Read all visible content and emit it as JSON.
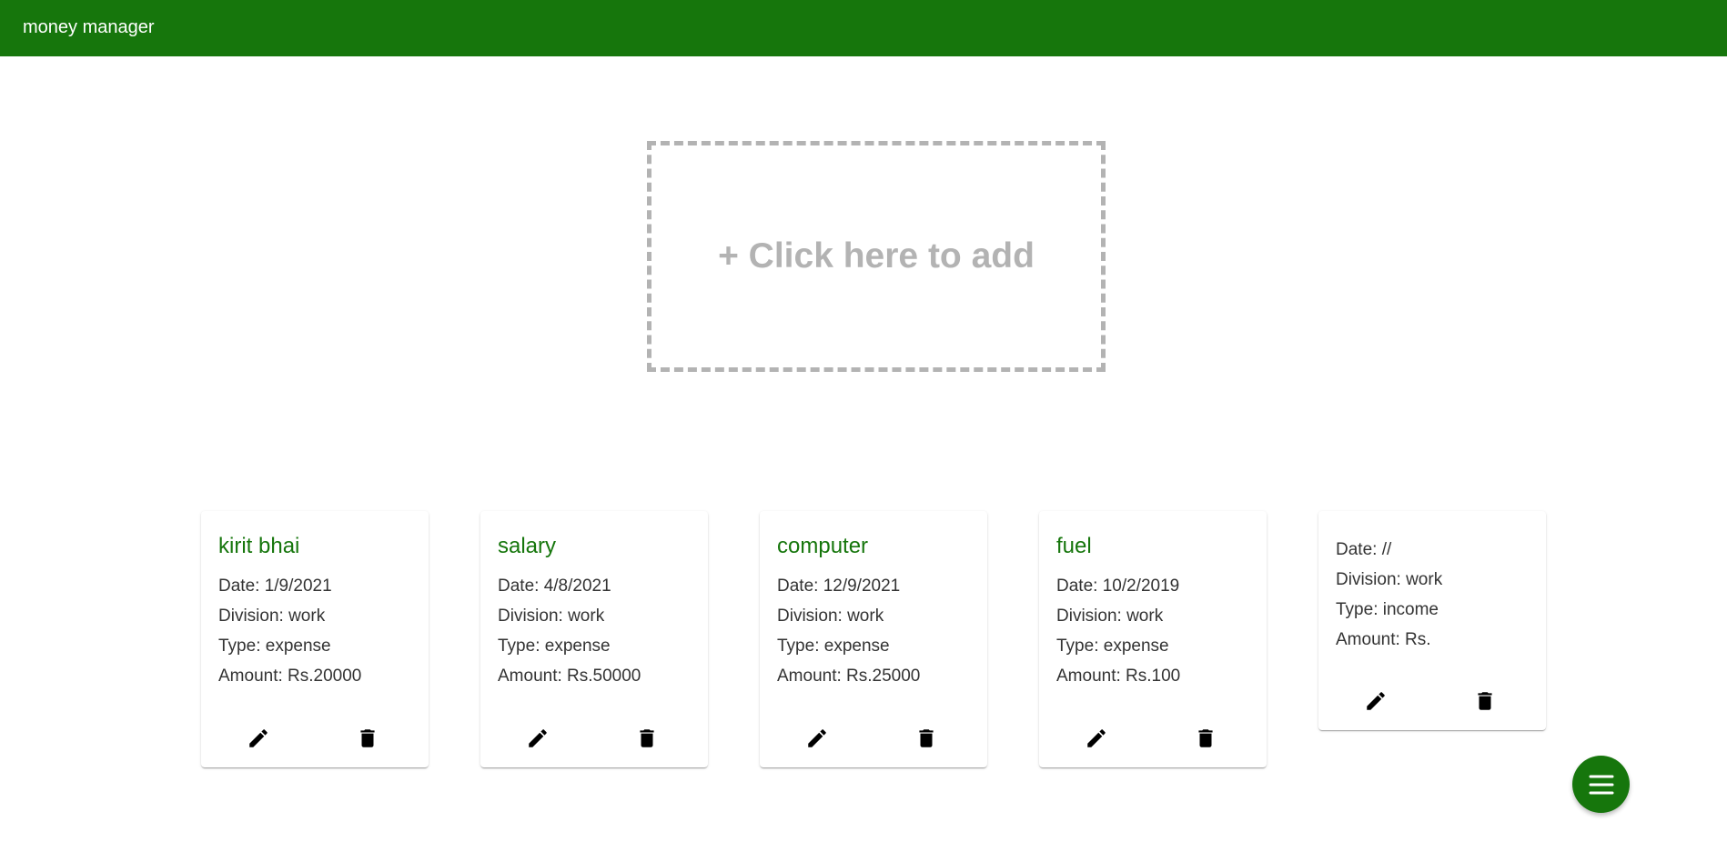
{
  "appbar": {
    "title": "money manager"
  },
  "add_box": {
    "label": "+ Click here to add"
  },
  "entries": [
    {
      "title": "kirit bhai",
      "date": "Date: 1/9/2021",
      "division": "Division: work",
      "type": "Type: expense",
      "amount": "Amount: Rs.20000"
    },
    {
      "title": "salary",
      "date": "Date: 4/8/2021",
      "division": "Division: work",
      "type": "Type: expense",
      "amount": "Amount: Rs.50000"
    },
    {
      "title": "computer",
      "date": "Date: 12/9/2021",
      "division": "Division: work",
      "type": "Type: expense",
      "amount": "Amount: Rs.25000"
    },
    {
      "title": "fuel",
      "date": "Date: 10/2/2019",
      "division": "Division: work",
      "type": "Type: expense",
      "amount": "Amount: Rs.100"
    },
    {
      "title": "",
      "date": "Date: //",
      "division": "Division: work",
      "type": "Type: income",
      "amount": "Amount: Rs."
    }
  ],
  "icons": {
    "edit": "pencil-icon",
    "delete": "trash-icon",
    "menu": "hamburger-menu-icon"
  },
  "colors": {
    "primary": "#16760c",
    "dashed_border": "#b3b3b3",
    "text": "#333333"
  }
}
